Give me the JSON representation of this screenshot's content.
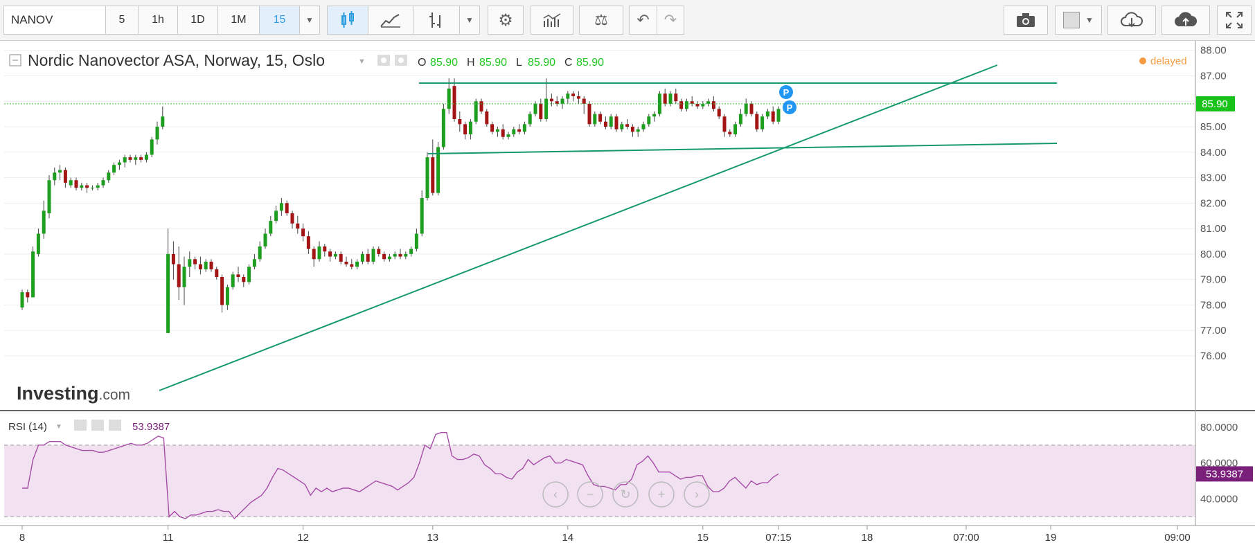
{
  "toolbar": {
    "symbol": "NANOV",
    "intervals": [
      "5",
      "1h",
      "1D",
      "1M",
      "15"
    ],
    "active_interval": "15",
    "icons": [
      "candles-icon",
      "line-chart-icon",
      "bar-chart-icon",
      "settings-icon",
      "indicators-icon",
      "compare-icon",
      "undo-icon",
      "redo-icon",
      "camera-icon",
      "color-box-icon",
      "cloud-download-icon",
      "cloud-upload-icon",
      "fullscreen-icon"
    ]
  },
  "header": {
    "title": "Nordic Nanovector ASA, Norway, 15, Oslo",
    "o_label": "O",
    "o_value": "85.90",
    "h_label": "H",
    "h_value": "85.90",
    "l_label": "L",
    "l_value": "85.90",
    "c_label": "C",
    "c_value": "85.90",
    "delayed": "delayed"
  },
  "watermark": {
    "bold": "Investing",
    "light": ".com"
  },
  "rsi": {
    "label": "RSI (14)",
    "value": "53.9387"
  },
  "colors": {
    "up": "#1e9e1e",
    "down": "#a31515",
    "trend": "#17996e",
    "rsi_line": "#a64ca6",
    "rsi_band": "#f1e1f1",
    "price_badge": "#19c21a",
    "rsi_badge": "#7a1f7a",
    "delayed_dot": "#f59b42"
  },
  "chart_data": [
    {
      "type": "candlestick",
      "title": "Nordic Nanovector ASA, Norway, 15, Oslo",
      "x_ticks": [
        "8",
        "11",
        "12",
        "13",
        "14",
        "15",
        "07:15",
        "18",
        "07:00",
        "19",
        "09:00"
      ],
      "y_ticks": [
        "76.00",
        "77.00",
        "78.00",
        "79.00",
        "80.00",
        "81.00",
        "82.00",
        "83.00",
        "84.00",
        "85.00",
        "86.00",
        "87.00",
        "88.00"
      ],
      "ylim": [
        76,
        88.1
      ],
      "last_price": "85.90",
      "ohlc": [
        [
          77.9,
          78.6,
          77.8,
          78.5
        ],
        [
          78.5,
          78.6,
          78.1,
          78.3
        ],
        [
          78.3,
          80.3,
          78.9,
          80.1
        ],
        [
          80.0,
          81.0,
          79.9,
          80.8
        ],
        [
          80.8,
          82.1,
          80.6,
          81.7
        ],
        [
          81.6,
          83.1,
          81.4,
          82.9
        ],
        [
          82.9,
          83.4,
          82.7,
          83.2
        ],
        [
          83.2,
          83.5,
          82.9,
          83.3
        ],
        [
          83.3,
          83.4,
          82.6,
          82.8
        ],
        [
          82.7,
          83.0,
          82.6,
          82.9
        ],
        [
          82.9,
          83.0,
          82.5,
          82.6
        ],
        [
          82.6,
          82.8,
          82.5,
          82.7
        ],
        [
          82.7,
          82.8,
          82.4,
          82.6
        ],
        [
          82.6,
          82.7,
          82.5,
          82.6
        ],
        [
          82.6,
          82.8,
          82.5,
          82.7
        ],
        [
          82.7,
          83.0,
          82.6,
          82.9
        ],
        [
          82.9,
          83.3,
          82.8,
          83.2
        ],
        [
          83.2,
          83.6,
          83.1,
          83.5
        ],
        [
          83.5,
          83.7,
          83.3,
          83.6
        ],
        [
          83.6,
          83.9,
          83.4,
          83.8
        ],
        [
          83.8,
          83.9,
          83.6,
          83.7
        ],
        [
          83.7,
          83.9,
          83.5,
          83.8
        ],
        [
          83.8,
          83.9,
          83.6,
          83.7
        ],
        [
          83.7,
          84.0,
          83.6,
          83.9
        ],
        [
          83.9,
          84.6,
          83.8,
          84.5
        ],
        [
          84.5,
          85.2,
          84.3,
          85.0
        ],
        [
          85.0,
          85.8,
          84.9,
          85.4
        ],
        [
          76.9,
          81.0,
          76.9,
          80.0
        ],
        [
          80.0,
          80.5,
          79.0,
          79.6
        ],
        [
          79.6,
          80.3,
          78.2,
          78.7
        ],
        [
          78.7,
          79.9,
          78.0,
          79.5
        ],
        [
          79.5,
          80.1,
          79.1,
          79.8
        ],
        [
          79.8,
          79.9,
          79.4,
          79.6
        ],
        [
          79.6,
          79.9,
          79.2,
          79.4
        ],
        [
          79.4,
          79.8,
          79.3,
          79.7
        ],
        [
          79.7,
          79.8,
          79.3,
          79.4
        ],
        [
          79.4,
          79.5,
          79.0,
          79.1
        ],
        [
          79.1,
          79.2,
          77.7,
          78.0
        ],
        [
          78.0,
          78.8,
          77.8,
          78.7
        ],
        [
          78.7,
          79.3,
          78.6,
          79.2
        ],
        [
          79.2,
          79.5,
          78.9,
          79.1
        ],
        [
          79.1,
          79.2,
          78.7,
          78.9
        ],
        [
          78.9,
          79.6,
          78.8,
          79.5
        ],
        [
          79.5,
          80.0,
          79.4,
          79.8
        ],
        [
          79.8,
          80.5,
          79.7,
          80.3
        ],
        [
          80.3,
          81.0,
          80.2,
          80.8
        ],
        [
          80.8,
          81.5,
          80.7,
          81.3
        ],
        [
          81.3,
          81.9,
          81.2,
          81.7
        ],
        [
          81.7,
          82.2,
          81.5,
          82.0
        ],
        [
          82.0,
          82.1,
          81.5,
          81.6
        ],
        [
          81.6,
          81.7,
          81.0,
          81.2
        ],
        [
          81.2,
          81.5,
          80.8,
          81.0
        ],
        [
          81.0,
          81.2,
          80.5,
          80.7
        ],
        [
          80.7,
          80.9,
          80.0,
          80.2
        ],
        [
          80.2,
          80.3,
          79.5,
          79.8
        ],
        [
          79.8,
          80.5,
          79.7,
          80.3
        ],
        [
          80.3,
          80.4,
          79.9,
          80.1
        ],
        [
          80.1,
          80.2,
          79.7,
          79.9
        ],
        [
          79.9,
          80.1,
          79.8,
          80.0
        ],
        [
          80.0,
          80.1,
          79.6,
          79.7
        ],
        [
          79.7,
          79.9,
          79.5,
          79.6
        ],
        [
          79.6,
          79.8,
          79.4,
          79.5
        ],
        [
          79.5,
          79.8,
          79.4,
          79.7
        ],
        [
          79.7,
          80.1,
          79.6,
          80.0
        ],
        [
          80.0,
          80.2,
          79.6,
          79.7
        ],
        [
          79.7,
          80.3,
          79.6,
          80.2
        ],
        [
          80.2,
          80.3,
          79.9,
          80.0
        ],
        [
          80.0,
          80.1,
          79.7,
          79.8
        ],
        [
          79.8,
          80.0,
          79.7,
          79.9
        ],
        [
          79.9,
          80.1,
          79.8,
          80.0
        ],
        [
          80.0,
          80.2,
          79.8,
          79.9
        ],
        [
          79.9,
          80.1,
          79.8,
          80.0
        ],
        [
          80.0,
          80.3,
          79.9,
          80.2
        ],
        [
          80.2,
          81.0,
          80.1,
          80.8
        ],
        [
          80.8,
          82.5,
          80.7,
          82.2
        ],
        [
          82.2,
          84.0,
          82.1,
          83.8
        ],
        [
          83.8,
          84.5,
          82.3,
          82.4
        ],
        [
          82.4,
          84.4,
          82.3,
          84.2
        ],
        [
          84.2,
          85.9,
          84.1,
          85.7
        ],
        [
          85.7,
          86.9,
          85.5,
          86.5
        ],
        [
          86.6,
          86.9,
          85.2,
          85.3
        ],
        [
          85.3,
          85.6,
          84.8,
          85.1
        ],
        [
          85.1,
          85.2,
          84.5,
          84.7
        ],
        [
          84.7,
          85.3,
          84.5,
          85.2
        ],
        [
          85.2,
          86.1,
          85.1,
          86.0
        ],
        [
          86.0,
          86.1,
          85.5,
          85.6
        ],
        [
          85.6,
          85.7,
          85.0,
          85.1
        ],
        [
          85.1,
          85.2,
          84.7,
          84.8
        ],
        [
          84.8,
          85.0,
          84.6,
          84.9
        ],
        [
          84.9,
          85.1,
          84.5,
          84.6
        ],
        [
          84.6,
          84.8,
          84.5,
          84.7
        ],
        [
          84.7,
          85.0,
          84.6,
          84.9
        ],
        [
          84.9,
          85.1,
          84.7,
          84.8
        ],
        [
          84.8,
          85.2,
          84.7,
          85.1
        ],
        [
          85.1,
          85.6,
          85.0,
          85.5
        ],
        [
          85.5,
          86.0,
          85.4,
          85.9
        ],
        [
          85.9,
          86.1,
          85.2,
          85.3
        ],
        [
          85.3,
          86.9,
          85.2,
          86.1
        ],
        [
          86.1,
          86.3,
          85.8,
          86.0
        ],
        [
          86.0,
          86.2,
          85.8,
          85.9
        ],
        [
          85.9,
          86.2,
          85.7,
          86.1
        ],
        [
          86.1,
          86.4,
          85.9,
          86.3
        ],
        [
          86.3,
          86.4,
          86.0,
          86.2
        ],
        [
          86.2,
          86.4,
          85.9,
          86.1
        ],
        [
          86.1,
          86.2,
          85.5,
          85.9
        ],
        [
          85.9,
          86.0,
          85.0,
          85.1
        ],
        [
          85.1,
          85.6,
          85.0,
          85.5
        ],
        [
          85.5,
          85.6,
          85.1,
          85.2
        ],
        [
          85.2,
          85.4,
          84.9,
          85.0
        ],
        [
          85.0,
          85.5,
          84.9,
          85.4
        ],
        [
          85.4,
          85.5,
          84.8,
          84.9
        ],
        [
          84.9,
          85.2,
          84.8,
          85.1
        ],
        [
          85.1,
          85.3,
          84.9,
          85.0
        ],
        [
          85.0,
          85.1,
          84.6,
          84.8
        ],
        [
          84.8,
          85.0,
          84.6,
          84.9
        ],
        [
          84.9,
          85.2,
          84.8,
          85.1
        ],
        [
          85.1,
          85.5,
          85.0,
          85.4
        ],
        [
          85.4,
          85.6,
          85.2,
          85.5
        ],
        [
          85.5,
          86.4,
          85.4,
          86.3
        ],
        [
          86.3,
          86.5,
          85.8,
          85.9
        ],
        [
          85.9,
          86.4,
          85.8,
          86.3
        ],
        [
          86.3,
          86.5,
          85.9,
          86.0
        ],
        [
          86.0,
          86.1,
          85.6,
          85.7
        ],
        [
          85.7,
          86.1,
          85.6,
          86.0
        ],
        [
          86.0,
          86.2,
          85.8,
          85.9
        ],
        [
          85.9,
          86.0,
          85.7,
          85.8
        ],
        [
          85.8,
          86.0,
          85.7,
          85.9
        ],
        [
          85.9,
          86.1,
          85.8,
          86.0
        ],
        [
          86.0,
          86.2,
          85.6,
          85.7
        ],
        [
          85.7,
          85.8,
          85.3,
          85.4
        ],
        [
          85.4,
          85.5,
          84.6,
          84.8
        ],
        [
          84.8,
          84.9,
          84.6,
          84.7
        ],
        [
          84.7,
          85.2,
          84.6,
          85.1
        ],
        [
          85.1,
          85.7,
          85.0,
          85.5
        ],
        [
          85.5,
          86.1,
          85.4,
          85.9
        ],
        [
          85.9,
          86.0,
          85.4,
          85.5
        ],
        [
          85.5,
          85.6,
          84.8,
          84.9
        ],
        [
          84.9,
          85.5,
          84.8,
          85.4
        ],
        [
          85.4,
          85.7,
          85.3,
          85.6
        ],
        [
          85.6,
          85.8,
          85.1,
          85.2
        ],
        [
          85.2,
          85.8,
          85.1,
          85.7
        ]
      ],
      "tick_positions": [
        0,
        27,
        52,
        76,
        101,
        126,
        140
      ]
    },
    {
      "type": "line",
      "title": "RSI (14)",
      "y_ticks": [
        "40.0000",
        "60.0000",
        "80.0000"
      ],
      "ylim": [
        29,
        85
      ],
      "upper_band": 70,
      "lower_band": 30,
      "last_value": "53.9387",
      "values": [
        46,
        46,
        62,
        70,
        70,
        72,
        72,
        72,
        70,
        69,
        68,
        67,
        67,
        67,
        66,
        66,
        67,
        68,
        69,
        70,
        71,
        70,
        70,
        71,
        73,
        75,
        74,
        30,
        33,
        30,
        29,
        31,
        31,
        32,
        33,
        33,
        34,
        33,
        33,
        29,
        32,
        35,
        38,
        40,
        42,
        46,
        52,
        57,
        56,
        54,
        52,
        50,
        48,
        42,
        46,
        44,
        46,
        44,
        45,
        46,
        46,
        45,
        44,
        46,
        48,
        50,
        49,
        48,
        47,
        45,
        47,
        49,
        52,
        60,
        70,
        68,
        76,
        77,
        77,
        64,
        62,
        62,
        63,
        65,
        64,
        59,
        57,
        54,
        54,
        52,
        51,
        55,
        57,
        62,
        59,
        61,
        63,
        64,
        60,
        60,
        62,
        61,
        60,
        59,
        53,
        48,
        47,
        47,
        46,
        45,
        48,
        48,
        51,
        59,
        61,
        64,
        60,
        55,
        55,
        55,
        53,
        51,
        52,
        52,
        53,
        53,
        47,
        44,
        44,
        46,
        50,
        52,
        49,
        46,
        50,
        48,
        49,
        49,
        52,
        54
      ]
    }
  ]
}
